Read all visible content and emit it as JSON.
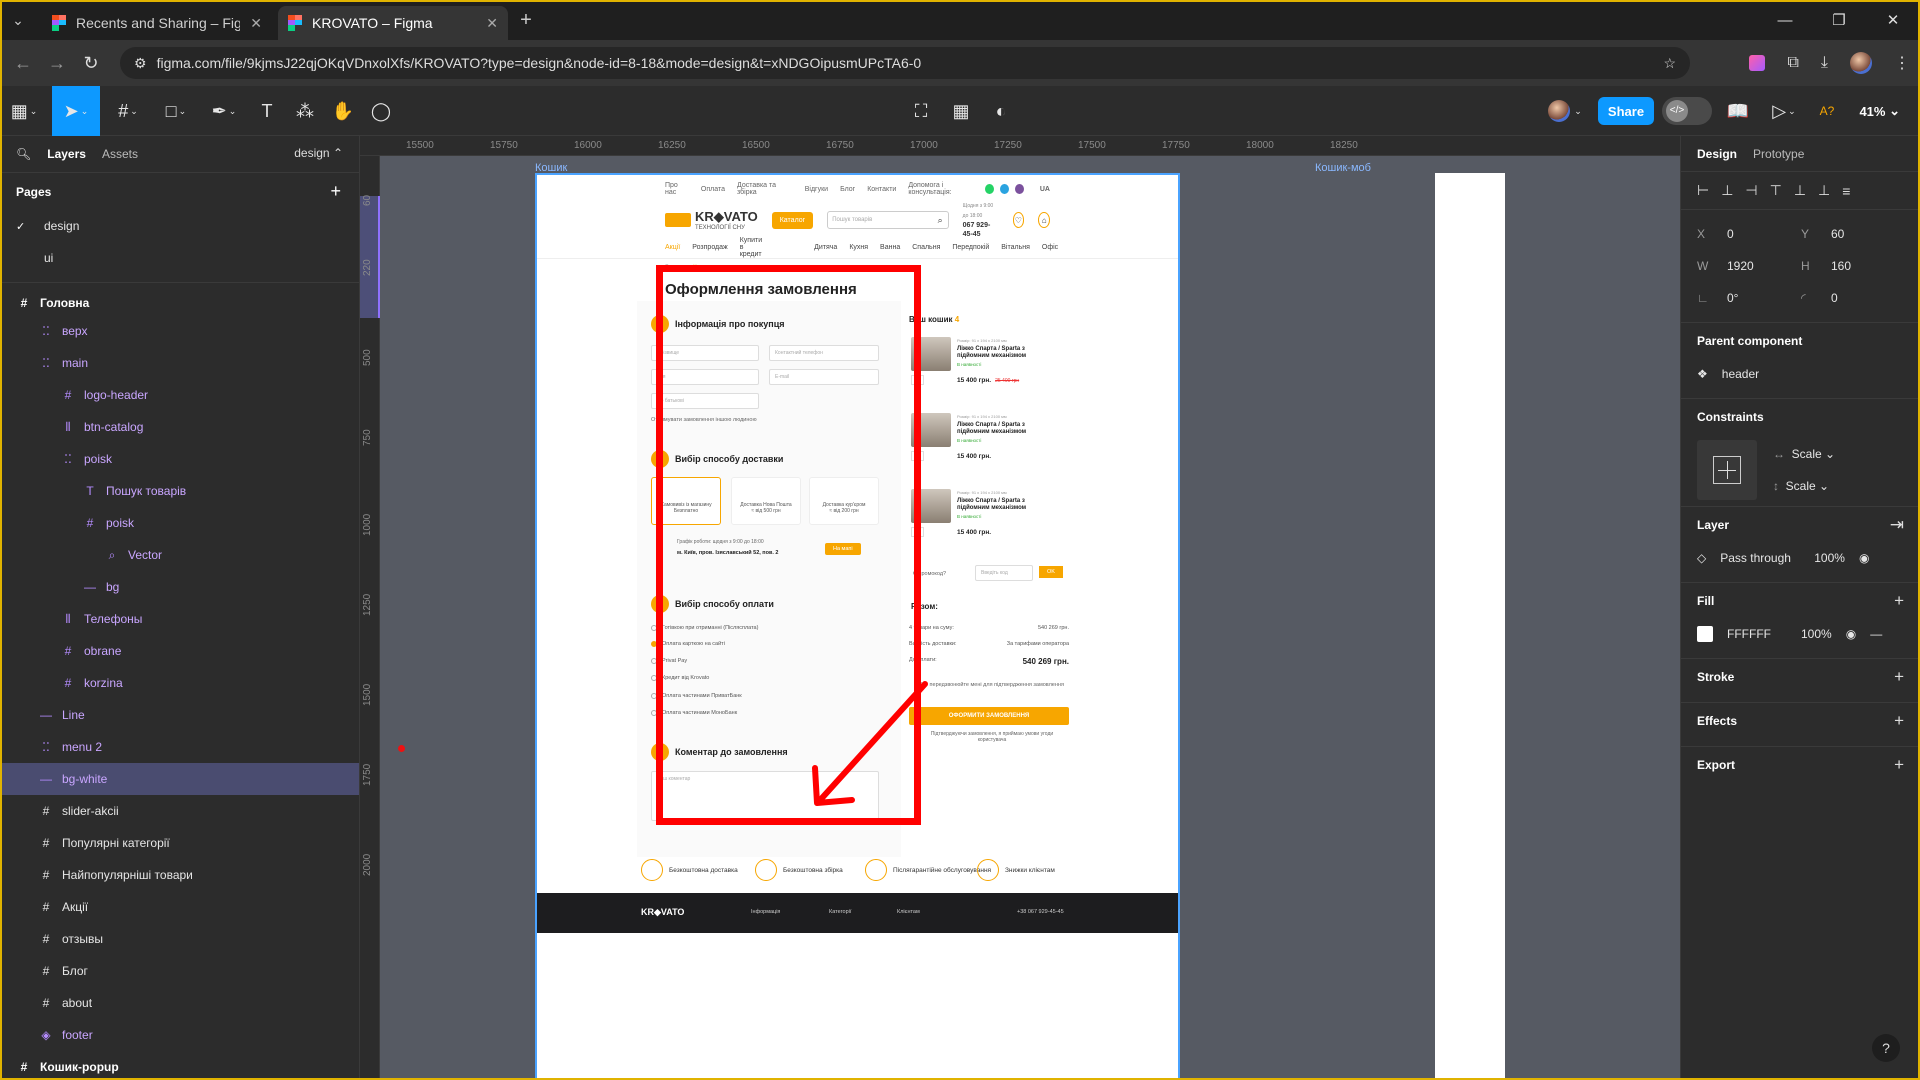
{
  "browser": {
    "tabs": [
      {
        "title": "Recents and Sharing – Figma",
        "active": false
      },
      {
        "title": "KROVATO – Figma",
        "active": true
      }
    ],
    "url": "figma.com/file/9kjmsJ22qjOKqVDnxolXfs/KROVATO?type=design&node-id=8-18&mode=design&t=xNDGOipusmUPcTA6-0"
  },
  "toolbar": {
    "share_label": "Share",
    "zoom": "41%",
    "accent": "#0d99ff"
  },
  "left_panel": {
    "tabs": [
      "Layers",
      "Assets"
    ],
    "page_selector": "design",
    "pages_title": "Pages",
    "pages": [
      {
        "name": "design",
        "current": true
      },
      {
        "name": "ui",
        "current": false
      }
    ],
    "layers": [
      {
        "name": "Головна",
        "type": "frame",
        "indent": 0
      },
      {
        "name": "верх",
        "type": "comp-group",
        "indent": 1
      },
      {
        "name": "main",
        "type": "comp-group",
        "indent": 1
      },
      {
        "name": "logo-header",
        "type": "comp-frame",
        "indent": 2
      },
      {
        "name": "btn-catalog",
        "type": "comp-auto",
        "indent": 2
      },
      {
        "name": "poisk",
        "type": "comp-group",
        "indent": 2
      },
      {
        "name": "Пошук товарів",
        "type": "comp-text",
        "indent": 3
      },
      {
        "name": "poisk",
        "type": "comp-frame",
        "indent": 3
      },
      {
        "name": "Vector",
        "type": "comp-vector",
        "indent": 4
      },
      {
        "name": "bg",
        "type": "comp-line",
        "indent": 3
      },
      {
        "name": "Телефоны",
        "type": "comp-auto",
        "indent": 2
      },
      {
        "name": "obrane",
        "type": "comp-frame",
        "indent": 2
      },
      {
        "name": "korzina",
        "type": "comp-frame",
        "indent": 2
      },
      {
        "name": "Line",
        "type": "comp-line",
        "indent": 1
      },
      {
        "name": "menu 2",
        "type": "comp-group",
        "indent": 1
      },
      {
        "name": "bg-white",
        "type": "comp-line",
        "indent": 1,
        "selected": true
      },
      {
        "name": "slider-akcii",
        "type": "frame-normal",
        "indent": 1
      },
      {
        "name": "Популярні категорії",
        "type": "frame-normal",
        "indent": 1
      },
      {
        "name": "Найпопулярніші товари",
        "type": "frame-normal",
        "indent": 1
      },
      {
        "name": "Акції",
        "type": "frame-normal",
        "indent": 1
      },
      {
        "name": "отзывы",
        "type": "frame-normal",
        "indent": 1
      },
      {
        "name": "Блог",
        "type": "frame-normal",
        "indent": 1
      },
      {
        "name": "about",
        "type": "frame-normal",
        "indent": 1
      },
      {
        "name": "footer",
        "type": "comp-instance",
        "indent": 1
      },
      {
        "name": "Кошик-popup",
        "type": "frame",
        "indent": 0
      }
    ]
  },
  "canvas": {
    "ruler_top": [
      "15500",
      "15750",
      "16000",
      "16250",
      "16500",
      "16750",
      "17000",
      "17250",
      "17500",
      "17750",
      "18000",
      "18250"
    ],
    "ruler_left": [
      "60",
      "220",
      "500",
      "750",
      "1000",
      "1250",
      "1500",
      "1750",
      "2000"
    ],
    "frame_label": "Кошик",
    "frame_label_right": "Кошик-моб",
    "design": {
      "top_links": [
        "Про нас",
        "Оплата",
        "Доставка та збірка",
        "Відгуки",
        "Блог",
        "Контакти"
      ],
      "help_text": "Допомога і консультація:",
      "lang": "UA",
      "logo_main": "KR◆VATO",
      "logo_sub": "ТЕХНОЛОГІЇ СНУ",
      "catalog_btn": "Каталог",
      "search_placeholder": "Пошук товарів",
      "phone_hours": "Щодня з 9:00 до 18:00",
      "phone": "067 929-45-45",
      "menu": [
        "Акції",
        "Розпродаж",
        "Купити в кредит",
        "Дитяча",
        "Кухня",
        "Ванна",
        "Спальня",
        "Передпокій",
        "Вітальня",
        "Офіс"
      ],
      "breadcrumb": [
        "Головна",
        "Кошик"
      ],
      "page_title": "Оформлення замовлення",
      "sec1": "Інформація про покупця",
      "inputs": [
        "Прізвище",
        "Контактний телефон",
        "Ім'я",
        "E-mail",
        "По батькові"
      ],
      "checkbox1": "Отримувати замовлення іншою людиною",
      "sec2": "Вибір способу доставки",
      "delivery": [
        {
          "title": "Самовивіз із магазину",
          "price": "Безплатно"
        },
        {
          "title": "Доставка Нова Пошта",
          "price": "≈ від 500 грн"
        },
        {
          "title": "Доставка кур'єром",
          "price": "≈ від 200 грн"
        }
      ],
      "schedule": "Графік роботи: щодня з 9:00 до 18:00",
      "address": "м. Київ, пров. Ізяславський 52, пов. 2",
      "map_btn": "На мапі",
      "sec3": "Вибір способу оплати",
      "payments": [
        "Готівкою при отриманні (Післясплата)",
        "Оплата карткою на сайті",
        "Privat Pay",
        "Кредит від Krovato",
        "Оплата частинами ПриватБанк",
        "Оплата частинами МоноБанк"
      ],
      "payment_selected": 1,
      "sec4": "Коментар до замовлення",
      "comment_placeholder": "Ваш коментар",
      "cart_title": "Ваш кошик",
      "cart_count": "4",
      "cart_items": [
        {
          "size": "Розмір: 91 x 194 x 2100 мм",
          "name": "Ліжко Спарта / Sparta з підйомним механізмом",
          "avail": "В наявності",
          "qty": "1",
          "price": "15 400 грн.",
          "old": "25 400 грн"
        },
        {
          "size": "Розмір: 91 x 194 x 2100 мм",
          "name": "Ліжко Спарта / Sparta з підйомним механізмом",
          "avail": "В наявності",
          "qty": "2",
          "price": "15 400 грн.",
          "old": ""
        },
        {
          "size": "Розмір: 91 x 194 x 2100 мм",
          "name": "Ліжко Спарта / Sparta з підйомним механізмом",
          "avail": "В наявності",
          "qty": "1",
          "price": "15 400 грн.",
          "old": ""
        }
      ],
      "promo_label": "Є промокод?",
      "promo_placeholder": "Введіть код",
      "promo_btn": "OK",
      "totals_title": "Разом:",
      "totals": [
        {
          "k": "4 товари на суму:",
          "v": "540 269 грн."
        },
        {
          "k": "Вартість доставки:",
          "v": "За тарифами оператора"
        },
        {
          "k": "До оплати:",
          "v": "540 269 грн."
        }
      ],
      "no_call": "Не передзвонюйте мені для підтвердження замовлення",
      "order_btn": "ОФОРМИТИ ЗАМОВЛЕННЯ",
      "agree": "Підтверджуючи замовлення, я приймаю умови угоди користувача",
      "features": [
        "Безкоштовна доставка",
        "Безкоштовна збірка",
        "Післягарантійне обслуговування",
        "Знижки клієнтам"
      ],
      "footer_items": [
        "Інформація",
        "Категорії",
        "Клієнтам",
        "+38 067 929-45-45"
      ],
      "accent": "#f7a600"
    },
    "annotation_color": "#ff0000"
  },
  "right_panel": {
    "tabs": [
      "Design",
      "Prototype"
    ],
    "x": "0",
    "y": "60",
    "w": "1920",
    "h": "160",
    "rotation": "0°",
    "radius": "0",
    "parent_component_title": "Parent component",
    "parent_component": "header",
    "constraints_title": "Constraints",
    "constraint_h": "Scale",
    "constraint_v": "Scale",
    "layer_title": "Layer",
    "blend": "Pass through",
    "opacity": "100%",
    "fill_title": "Fill",
    "fill_hex": "FFFFFF",
    "fill_opacity": "100%",
    "stroke_title": "Stroke",
    "effects_title": "Effects",
    "export_title": "Export"
  }
}
